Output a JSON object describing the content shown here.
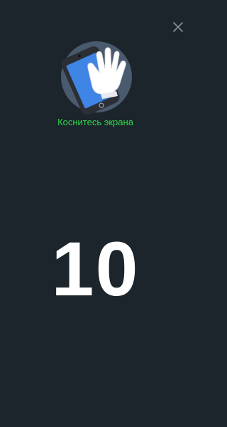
{
  "header": {
    "close_icon": "close-icon"
  },
  "hero": {
    "icon": "touch-phone-hand-icon",
    "instruction": "Коснитесь экрана"
  },
  "countdown": {
    "value": "10"
  },
  "colors": {
    "background": "#1b252b",
    "accent_text": "#32d74b",
    "circle": "#4a5a6e",
    "phone_body": "#2b2f35",
    "phone_screen": "#3f85e6",
    "hand": "#ffffff"
  }
}
